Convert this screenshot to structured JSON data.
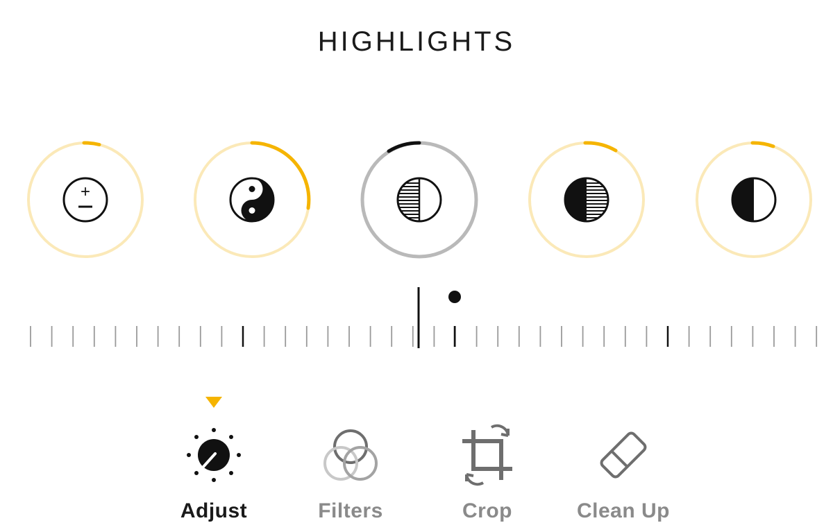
{
  "title": "HIGHLIGHTS",
  "colors": {
    "accent": "#f5b400",
    "ring_inactive": "#fbe9b8",
    "ring_selected": "#b9b9b9",
    "icon": "#111111",
    "label_inactive": "#8a8a8a"
  },
  "adjustments": [
    {
      "name": "exposure",
      "icon": "plus-minus-icon",
      "selected": false
    },
    {
      "name": "brilliance",
      "icon": "yin-yang-icon",
      "selected": false
    },
    {
      "name": "highlights",
      "icon": "highlights-icon",
      "selected": true
    },
    {
      "name": "shadows",
      "icon": "shadows-icon",
      "selected": false
    },
    {
      "name": "contrast",
      "icon": "contrast-icon",
      "selected": false
    }
  ],
  "tabs": [
    {
      "label": "Adjust",
      "icon": "dial-icon",
      "active": true
    },
    {
      "label": "Filters",
      "icon": "filters-icon",
      "active": false
    },
    {
      "label": "Crop",
      "icon": "crop-icon",
      "active": false
    },
    {
      "label": "Clean Up",
      "icon": "eraser-icon",
      "active": false
    }
  ]
}
